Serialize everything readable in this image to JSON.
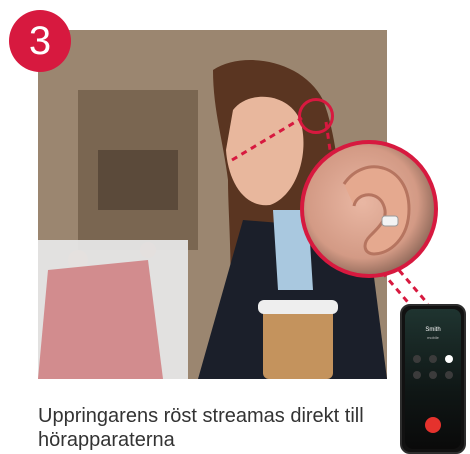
{
  "step": {
    "number": "3"
  },
  "phone": {
    "caller_name": "Smith",
    "caller_status": "mobile"
  },
  "caption": {
    "text": "Uppringarens röst streamas direkt till hörapparaterna"
  },
  "colors": {
    "accent": "#d7193f",
    "caption": "#333333",
    "end_call": "#e5322d"
  }
}
